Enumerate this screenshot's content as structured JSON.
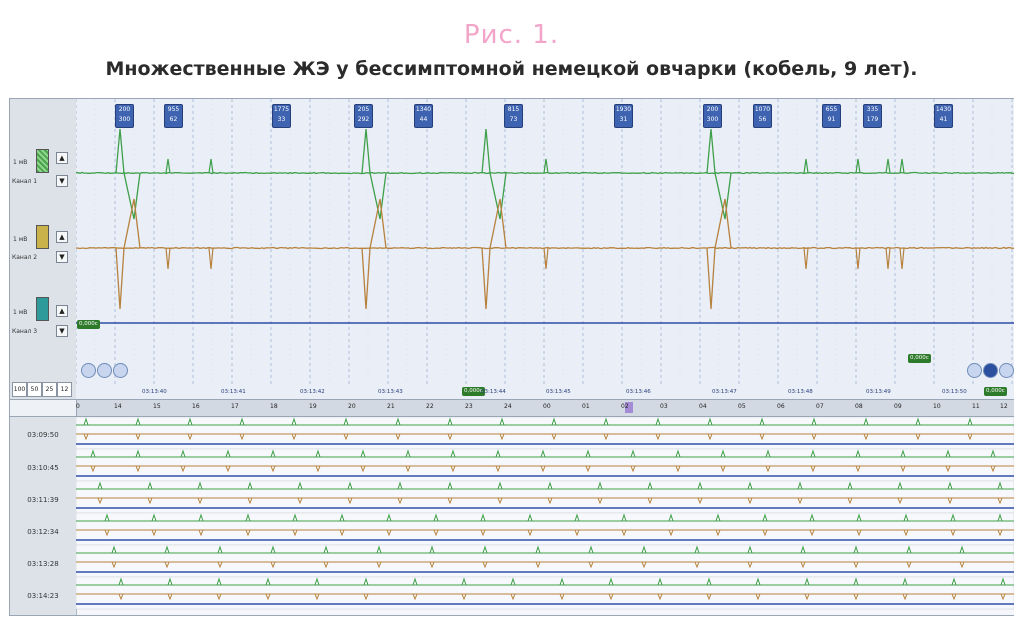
{
  "figure": {
    "title": "Рис. 1.",
    "caption": "Множественные ЖЭ у бессимптомной немецкой овчарки (кобель, 9 лет)."
  },
  "channels": [
    {
      "scale": "1 мВ",
      "name": "Канал 1",
      "color": "#4aa54a"
    },
    {
      "scale": "1 мВ",
      "name": "Канал 2",
      "color": "#c9b24a"
    },
    {
      "scale": "1 мВ",
      "name": "Канал 3",
      "color": "#2e9a9a"
    }
  ],
  "zoom_buttons": [
    "100",
    "50",
    "25",
    "12"
  ],
  "heart_rate_boxes": [
    {
      "a": "200",
      "b": "300"
    },
    {
      "a": "955",
      "b": "62"
    },
    {
      "a": "1775",
      "b": "33"
    },
    {
      "a": "205",
      "b": "292"
    },
    {
      "a": "1340",
      "b": "44"
    },
    {
      "a": "815",
      "b": "73"
    },
    {
      "a": "1930",
      "b": "31"
    },
    {
      "a": "200",
      "b": "300"
    },
    {
      "a": "1070",
      "b": "56"
    },
    {
      "a": "655",
      "b": "91"
    },
    {
      "a": "335",
      "b": "179"
    },
    {
      "a": "1430",
      "b": "41"
    }
  ],
  "time_labels": [
    "03:13:40",
    "03:13:41",
    "03:13:42",
    "03:13:43",
    "03:13:44",
    "03:13:45",
    "03:13:46",
    "03:13:47",
    "03:13:48",
    "03:13:49",
    "03:13:50"
  ],
  "cursor_tags": {
    "ch3_start": "0,000с",
    "mid": "0,000с",
    "right_small": "0,000с",
    "right_end": "0,000с"
  },
  "ruler_numbers": [
    "0",
    "14",
    "15",
    "16",
    "17",
    "18",
    "19",
    "20",
    "21",
    "22",
    "23",
    "24",
    "00",
    "01",
    "02",
    "03",
    "04",
    "05",
    "06",
    "07",
    "08",
    "09",
    "10",
    "11",
    "12"
  ],
  "overview_rows": [
    "03:09:50",
    "03:10:45",
    "03:11:39",
    "03:12:34",
    "03:13:28",
    "03:14:23"
  ],
  "colors": {
    "ecg_green": "#3fa04a",
    "ecg_brown": "#b7823d",
    "baseline_blue": "#2d4fa8",
    "grid": "#8aa0c8"
  }
}
